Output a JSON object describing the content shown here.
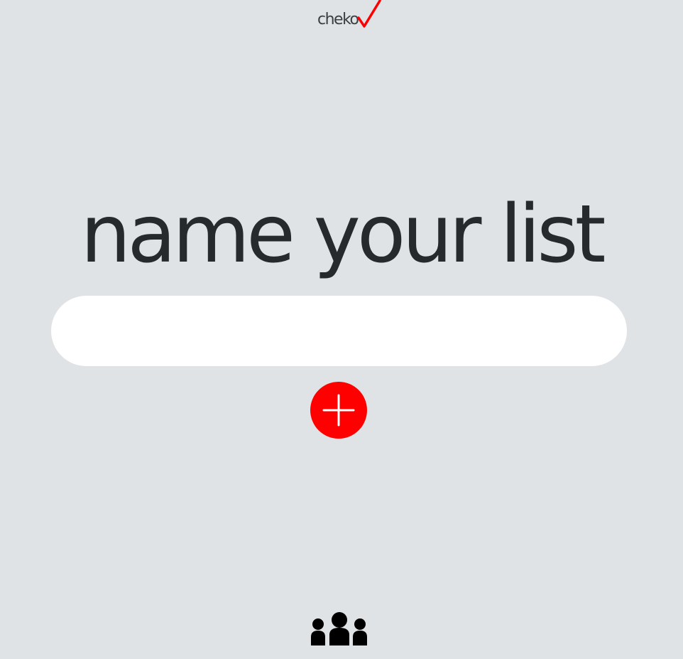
{
  "app": {
    "logo_text": "cheko",
    "logo_check_icon": "check-icon"
  },
  "colors": {
    "background": "#e0e3e6",
    "accent": "#ff0000",
    "text": "#272a2d",
    "input_background": "#ffffff"
  },
  "main": {
    "heading": "name your list",
    "name_input": {
      "value": "",
      "placeholder": ""
    },
    "add_button_icon": "plus-icon"
  },
  "footer": {
    "people_button_icon": "people-group-icon"
  }
}
